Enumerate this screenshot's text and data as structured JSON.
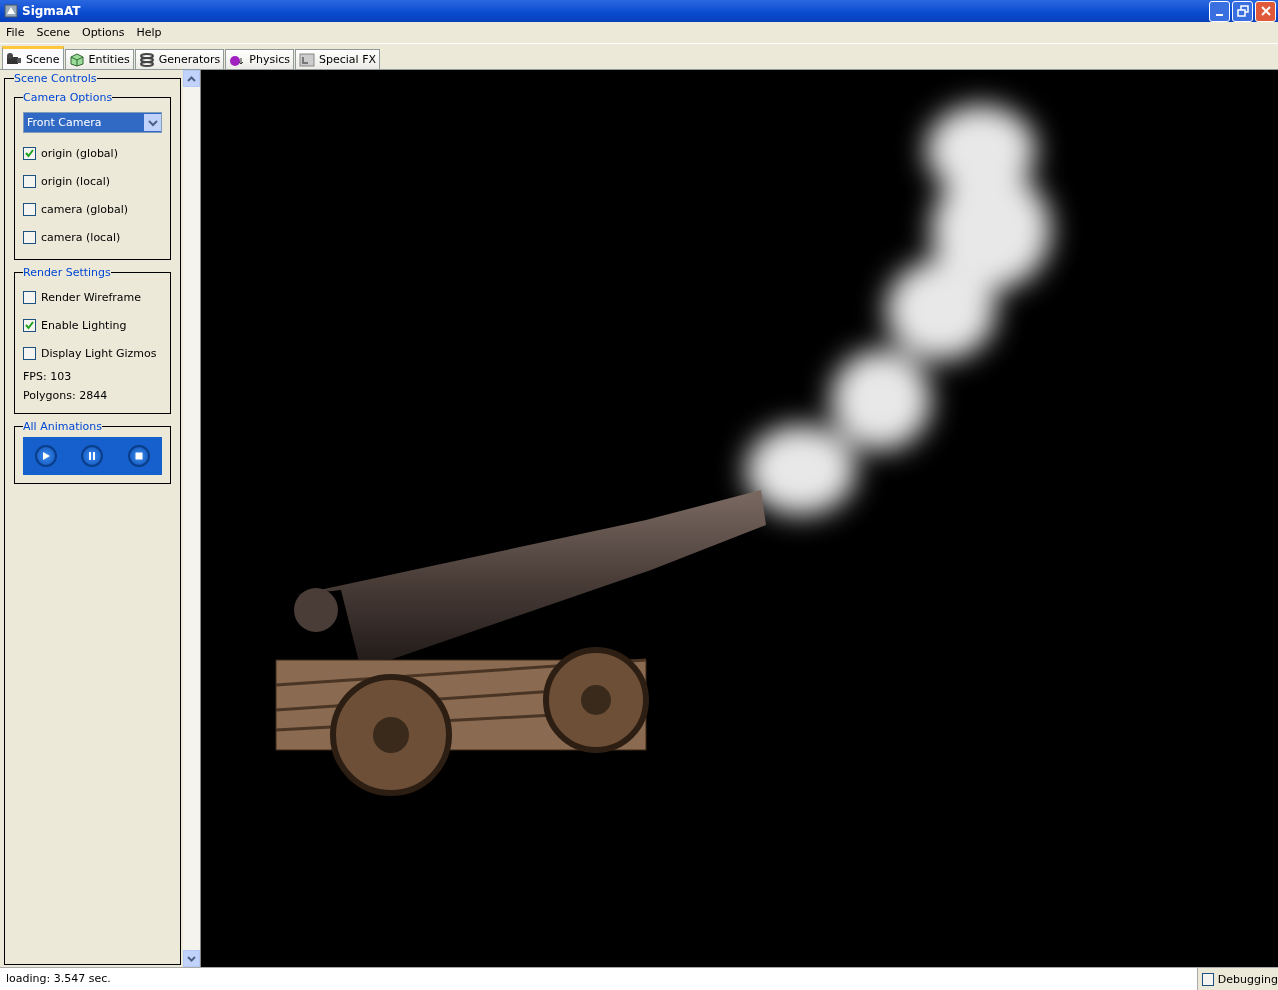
{
  "window": {
    "title": "SigmaAT"
  },
  "menu": [
    "File",
    "Scene",
    "Options",
    "Help"
  ],
  "tabs": [
    {
      "label": "Scene",
      "kind": "camera",
      "selected": true
    },
    {
      "label": "Entities",
      "kind": "cube",
      "selected": false
    },
    {
      "label": "Generators",
      "kind": "coil",
      "selected": false
    },
    {
      "label": "Physics",
      "kind": "ball",
      "selected": false
    },
    {
      "label": "Special FX",
      "kind": "fx",
      "selected": false
    }
  ],
  "scene_controls": {
    "title": "Scene Controls",
    "camera_options": {
      "title": "Camera Options",
      "camera": "Front Camera",
      "checkboxes": [
        {
          "label": "origin (global)",
          "checked": true
        },
        {
          "label": "origin (local)",
          "checked": false
        },
        {
          "label": "camera (global)",
          "checked": false
        },
        {
          "label": "camera (local)",
          "checked": false
        }
      ]
    },
    "render_settings": {
      "title": "Render Settings",
      "checkboxes": [
        {
          "label": "Render Wireframe",
          "checked": false
        },
        {
          "label": "Enable Lighting",
          "checked": true
        },
        {
          "label": "Display Light Gizmos",
          "checked": false
        }
      ],
      "stats": [
        "FPS: 103",
        "Polygons: 2844"
      ]
    },
    "all_animations": {
      "title": "All Animations",
      "buttons": [
        {
          "kind": "play"
        },
        {
          "kind": "pause"
        },
        {
          "kind": "stop"
        }
      ]
    }
  },
  "status_bar": {
    "text": "loading: 3.547 sec.",
    "debugging": {
      "label": "Debugging",
      "checked": false
    }
  }
}
